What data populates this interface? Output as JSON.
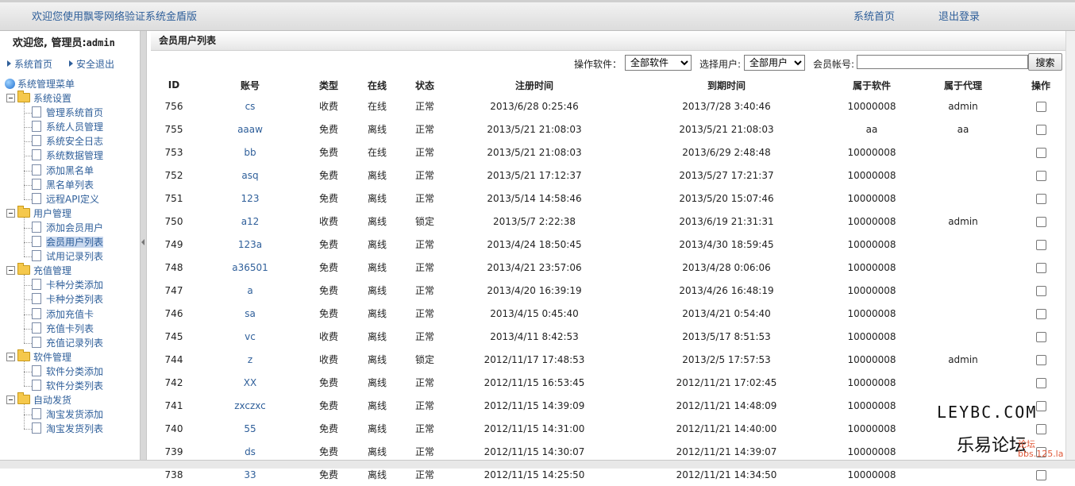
{
  "header": {
    "welcome": "欢迎您使用飘零网络验证系统金盾版",
    "home_link": "系统首页",
    "logout_link": "退出登录"
  },
  "sidebar": {
    "greeting": "欢迎您, 管理员:",
    "username": "admin",
    "quick_home": "系统首页",
    "quick_logout": "安全退出",
    "menu_title": "系统管理菜单",
    "groups": [
      {
        "label": "系统设置",
        "items": [
          "管理系统首页",
          "系统人员管理",
          "系统安全日志",
          "系统数据管理",
          "添加黑名单",
          "黑名单列表",
          "远程API定义"
        ]
      },
      {
        "label": "用户管理",
        "items": [
          "添加会员用户",
          "会员用户列表",
          "试用记录列表"
        ]
      },
      {
        "label": "充值管理",
        "items": [
          "卡种分类添加",
          "卡种分类列表",
          "添加充值卡",
          "充值卡列表",
          "充值记录列表"
        ]
      },
      {
        "label": "软件管理",
        "items": [
          "软件分类添加",
          "软件分类列表"
        ]
      },
      {
        "label": "自动发货",
        "items": [
          "淘宝发货添加",
          "淘宝发货列表"
        ]
      }
    ]
  },
  "main": {
    "title": "会员用户列表",
    "filters": {
      "software_label": "操作软件：",
      "software_value": "全部软件",
      "user_label": "选择用户:",
      "user_value": "全部用户",
      "account_label": "会员帐号:",
      "account_value": "",
      "search_button": "搜索"
    },
    "columns": [
      "ID",
      "账号",
      "类型",
      "在线",
      "状态",
      "注册时间",
      "到期时间",
      "属于软件",
      "属于代理",
      "操作"
    ],
    "rows": [
      [
        "756",
        "cs",
        "收费",
        "在线",
        "正常",
        "2013/6/28 0:25:46",
        "2013/7/28 3:40:46",
        "10000008",
        "admin"
      ],
      [
        "755",
        "aaaw",
        "免费",
        "离线",
        "正常",
        "2013/5/21 21:08:03",
        "2013/5/21 21:08:03",
        "aa",
        "aa"
      ],
      [
        "753",
        "bb",
        "免费",
        "在线",
        "正常",
        "2013/5/21 21:08:03",
        "2013/6/29 2:48:48",
        "10000008",
        ""
      ],
      [
        "752",
        "asq",
        "免费",
        "离线",
        "正常",
        "2013/5/21 17:12:37",
        "2013/5/27 17:21:37",
        "10000008",
        ""
      ],
      [
        "751",
        "123",
        "免费",
        "离线",
        "正常",
        "2013/5/14 14:58:46",
        "2013/5/20 15:07:46",
        "10000008",
        ""
      ],
      [
        "750",
        "a12",
        "收费",
        "离线",
        "锁定",
        "2013/5/7 2:22:38",
        "2013/6/19 21:31:31",
        "10000008",
        "admin"
      ],
      [
        "749",
        "123a",
        "免费",
        "离线",
        "正常",
        "2013/4/24 18:50:45",
        "2013/4/30 18:59:45",
        "10000008",
        ""
      ],
      [
        "748",
        "a36501",
        "免费",
        "离线",
        "正常",
        "2013/4/21 23:57:06",
        "2013/4/28 0:06:06",
        "10000008",
        ""
      ],
      [
        "747",
        "a",
        "免费",
        "离线",
        "正常",
        "2013/4/20 16:39:19",
        "2013/4/26 16:48:19",
        "10000008",
        ""
      ],
      [
        "746",
        "sa",
        "免费",
        "离线",
        "正常",
        "2013/4/15 0:45:40",
        "2013/4/21 0:54:40",
        "10000008",
        ""
      ],
      [
        "745",
        "vc",
        "收费",
        "离线",
        "正常",
        "2013/4/11 8:42:53",
        "2013/5/17 8:51:53",
        "10000008",
        ""
      ],
      [
        "744",
        "z",
        "收费",
        "离线",
        "锁定",
        "2012/11/17 17:48:53",
        "2013/2/5 17:57:53",
        "10000008",
        "admin"
      ],
      [
        "742",
        "XX",
        "免费",
        "离线",
        "正常",
        "2012/11/15 16:53:45",
        "2012/11/21 17:02:45",
        "10000008",
        ""
      ],
      [
        "741",
        "zxczxc",
        "免费",
        "离线",
        "正常",
        "2012/11/15 14:39:09",
        "2012/11/21 14:48:09",
        "10000008",
        ""
      ],
      [
        "740",
        "55",
        "免费",
        "离线",
        "正常",
        "2012/11/15 14:31:00",
        "2012/11/21 14:40:00",
        "10000008",
        ""
      ],
      [
        "739",
        "ds",
        "免费",
        "离线",
        "正常",
        "2012/11/15 14:30:07",
        "2012/11/21 14:39:07",
        "10000008",
        ""
      ],
      [
        "738",
        "33",
        "免费",
        "离线",
        "正常",
        "2012/11/15 14:25:50",
        "2012/11/21 14:34:50",
        "10000008",
        ""
      ]
    ]
  },
  "watermark": {
    "line1": "LEYBC.COM",
    "line2": "乐易论坛",
    "line3": "论坛",
    "line4": "bbs.125.la"
  },
  "colors": {
    "link": "#2f5f9a",
    "selected_bg": "#c7d7ee",
    "watermark_red": "#e05a3a"
  }
}
